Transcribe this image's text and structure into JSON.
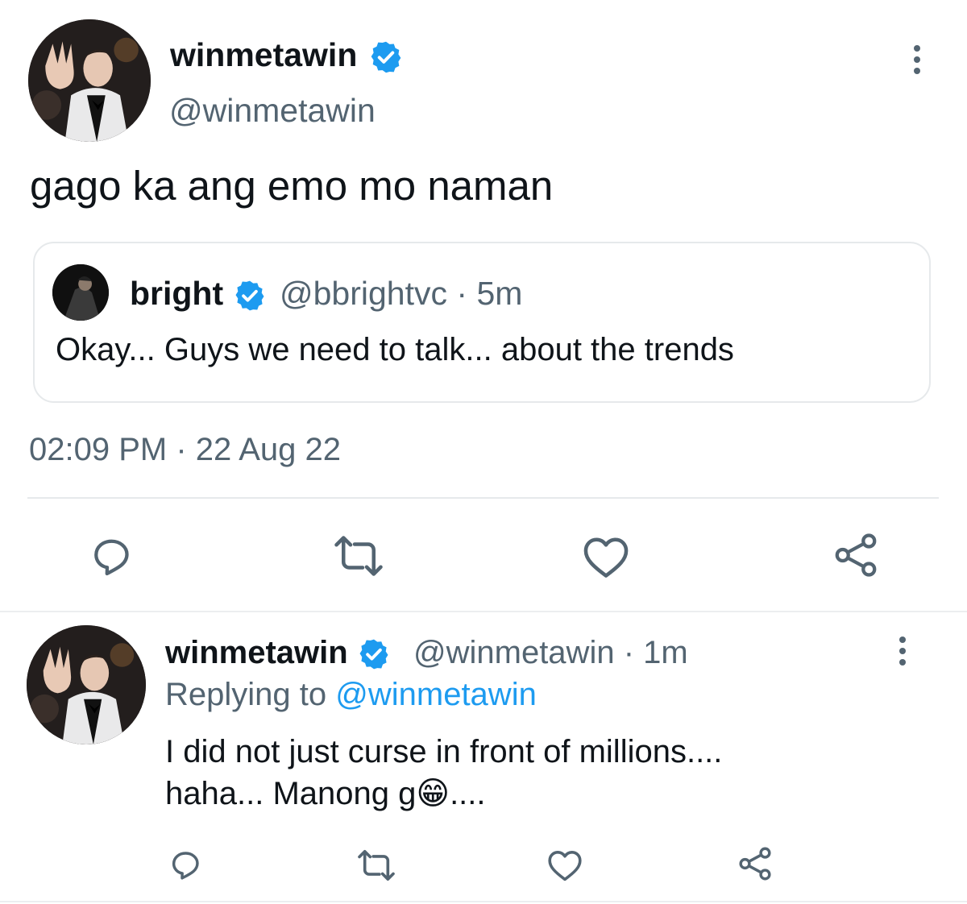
{
  "main_tweet": {
    "display_name": "winmetawin",
    "handle": "@winmetawin",
    "text": "gago ka ang emo mo naman",
    "timestamp": "02:09 PM",
    "separator": "·",
    "date": "22 Aug 22",
    "avatar_icon": "profile-photo-icon",
    "verified_icon": "verified-badge-icon"
  },
  "quoted_tweet": {
    "display_name": "bright",
    "handle": "@bbrightvc",
    "separator": "·",
    "time_ago": "5m",
    "text": "Okay... Guys we need to talk... about the trends"
  },
  "reply_tweet": {
    "display_name": "winmetawin",
    "handle": "@winmetawin",
    "separator": "·",
    "time_ago": "1m",
    "replying_prefix": "Replying to",
    "replying_to": "@winmetawin",
    "text_line1": "I did not just curse in front of millions....",
    "text_line2_prefix": "haha... Manong g",
    "text_line2_emoji": "😁",
    "text_line2_suffix": "...."
  },
  "actions": [
    "reply-icon",
    "retweet-icon",
    "like-icon",
    "share-icon"
  ],
  "colors": {
    "text": "#0f1419",
    "muted": "#536471",
    "link": "#1d9bf0",
    "verified": "#1d9bf0",
    "divider": "#e6e9eb"
  }
}
